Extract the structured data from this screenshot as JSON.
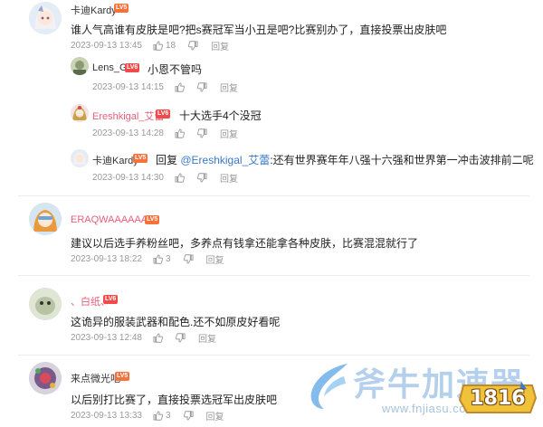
{
  "comments": [
    {
      "user": "卡迪Kardy",
      "level": "LV5",
      "text": "谁人气高谁有皮肤是吧?把s赛冠军当小丑是吧?比赛别办了，直接投票出皮肤吧",
      "time": "2023-09-13 13:45",
      "likes": "18",
      "reply": "回复",
      "replies": [
        {
          "user": "Lens_G",
          "level": "LV6",
          "text": "小恩不管吗",
          "time": "2023-09-13 14:15",
          "reply": "回复"
        },
        {
          "user": "Ereshkigal_艾蕾",
          "level": "LV6",
          "text": "十大选手4个没冠",
          "time": "2023-09-13 14:28",
          "reply": "回复"
        },
        {
          "user": "卡迪Kardy",
          "level": "LV5",
          "prefix": "回复",
          "mention": "@Ereshkigal_艾蕾",
          "text": ":还有世界赛年年八强十六强和世界第一冲击波排前二呢",
          "time": "2023-09-13 14:30",
          "reply": "回复"
        }
      ]
    },
    {
      "user": "ERAQWAAAAAAA",
      "level": "LV5",
      "text": "建议以后选手养粉丝吧，多养点有钱拿还能拿各种皮肤，比赛混混就行了",
      "time": "2023-09-13 18:22",
      "likes": "3",
      "reply": "回复"
    },
    {
      "user": "、白纸、",
      "level": "LV6",
      "text": "这诡异的服装武器和配色.还不如原皮好看呢",
      "time": "2023-09-13 12:48",
      "reply": "回复"
    },
    {
      "user": "来点微光吧",
      "level": "LV5",
      "text": "以后别打比赛了，直接投票选冠军出皮肤吧",
      "time": "2023-09-13 13:33",
      "likes": "3",
      "reply": "回复"
    }
  ],
  "watermark": {
    "brand": "斧牛加速器",
    "url": "www.fnjiasu.com",
    "badge": "1816"
  },
  "colors": {
    "accent_pink": "#e8607a",
    "level_badge": "#f7713a",
    "mention": "#3a78c8",
    "meta_gray": "#999999"
  }
}
